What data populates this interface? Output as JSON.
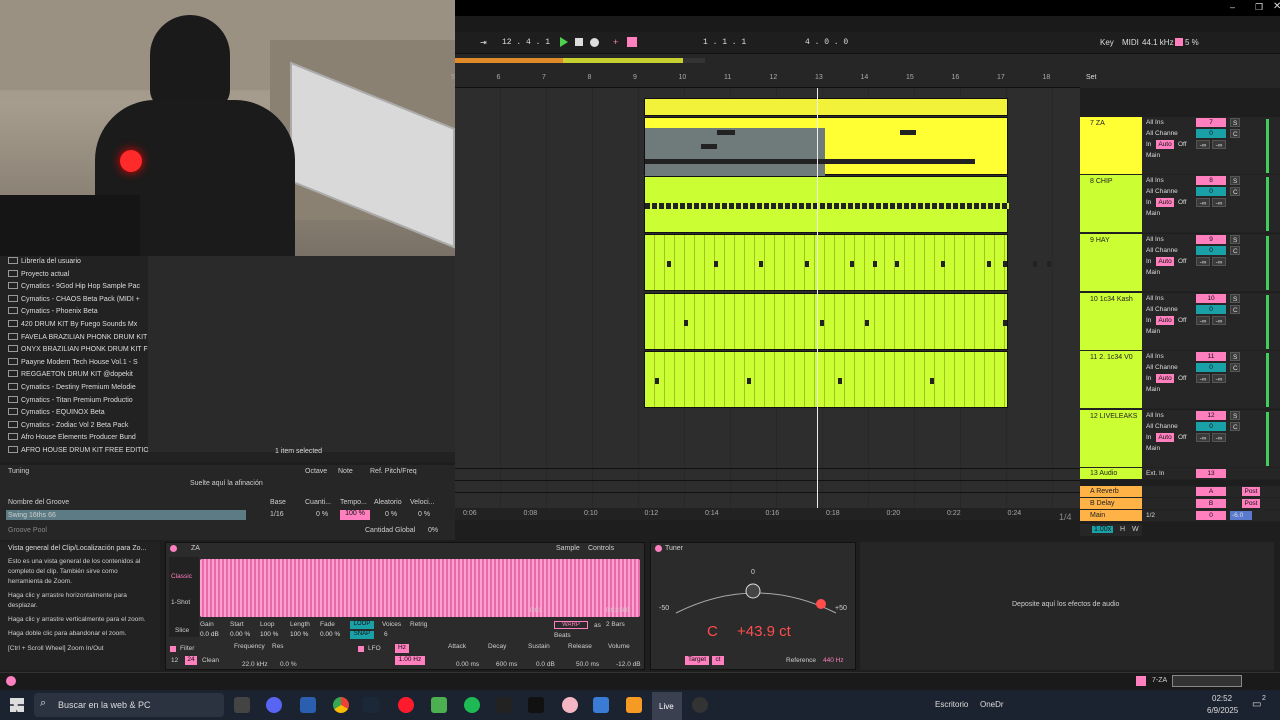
{
  "transport": {
    "tempo_left": "12 . 4 . 1",
    "position": "1 . 1 . 1",
    "loop_len": "4 . 0 . 0",
    "key_label": "Key",
    "midi_label": "MIDI",
    "sample_rate": "44.1 kHz",
    "cpu": "5 %"
  },
  "ruler": {
    "bars": [
      "5",
      "6",
      "7",
      "8",
      "9",
      "10",
      "11",
      "12",
      "13",
      "14",
      "15",
      "16",
      "17",
      "18"
    ],
    "times": [
      "0:06",
      "0:08",
      "0:10",
      "0:12",
      "0:14",
      "0:16",
      "0:18",
      "0:20",
      "0:22",
      "0:24"
    ],
    "zoom_page": "1/4",
    "set_label": "Set"
  },
  "tracks": [
    {
      "name": "7 ZA",
      "num": "7",
      "input": "All Ins",
      "channel": "All Channe",
      "in": "In",
      "auto": "Auto",
      "off": "Off",
      "out": "Main",
      "val": "-∞",
      "vol": "0",
      "s": "S",
      "c": "C",
      "color": "#ffff33"
    },
    {
      "name": "8 CHIP",
      "num": "8",
      "input": "All Ins",
      "channel": "All Channe",
      "in": "In",
      "auto": "Auto",
      "off": "Off",
      "out": "Main",
      "val": "-∞",
      "vol": "0",
      "s": "S",
      "c": "C",
      "color": "#ccff33"
    },
    {
      "name": "9 HAY",
      "num": "9",
      "input": "All Ins",
      "channel": "All Channe",
      "in": "In",
      "auto": "Auto",
      "off": "Off",
      "out": "Main",
      "val": "-∞",
      "vol": "0",
      "s": "S",
      "c": "C",
      "color": "#ccff33"
    },
    {
      "name": "10 1c34 Kash",
      "num": "10",
      "input": "All Ins",
      "channel": "All Channe",
      "in": "In",
      "auto": "Auto",
      "off": "Off",
      "out": "Main",
      "val": "-∞",
      "vol": "0",
      "s": "S",
      "c": "C",
      "color": "#ccff33"
    },
    {
      "name": "11 2. 1c34 V0",
      "num": "11",
      "input": "All Ins",
      "channel": "All Channe",
      "in": "In",
      "auto": "Auto",
      "off": "Off",
      "out": "Main",
      "val": "-∞",
      "vol": "0",
      "s": "S",
      "c": "C",
      "color": "#ccff33"
    },
    {
      "name": "12 LIVELEAKS",
      "num": "12",
      "input": "All Ins",
      "channel": "All Channe",
      "in": "In",
      "auto": "Auto",
      "off": "Off",
      "out": "Main",
      "val": "-∞",
      "vol": "0",
      "s": "S",
      "c": "C",
      "color": "#ccff33"
    }
  ],
  "aux": [
    {
      "name": "13 Audio",
      "input": "Ext. In",
      "num": "13"
    },
    {
      "name": "A Reverb",
      "num": "A",
      "post": "Post"
    },
    {
      "name": "B Delay",
      "num": "B",
      "post": "Post"
    },
    {
      "name": "Main",
      "num": "0",
      "out": "1/2",
      "vol": "-6.0"
    }
  ],
  "main_bottom": {
    "zoom": "1.00x",
    "h": "H",
    "w": "W"
  },
  "browser": {
    "items": [
      "Librería del usuario",
      "Proyecto actual",
      "Cymatics - 9God Hip Hop Sample Pac",
      "Cymatics - CHAOS Beta Pack (MIDI +",
      "Cymatics - Phoenix Beta",
      "420 DRUM KIT By Fuego Sounds Mx",
      "FAVELA BRAZILIAN PHONK DRUM KIT",
      "ONYX BRAZILIAN PHONK DRUM KIT F",
      "Paayne Modern Tech House Vol.1 - S",
      "REGGAETON DRUM KIT @dopekit",
      "Cymatics - Destiny Premium Melodie",
      "Cymatics - Titan Premium Productio",
      "Cymatics - EQUINOX Beta",
      "Cymatics - Zodiac Vol 2 Beta Pack",
      "Afro House Elements Producer Bund",
      "AFRO HOUSE DRUM KIT FREE EDITIOI"
    ],
    "status": "1 item selected"
  },
  "tuning": {
    "title": "Tuning",
    "cols": [
      "Octave",
      "Note",
      "Ref. Pitch/Freq"
    ],
    "drop": "Suelte aquí la afinación"
  },
  "groove": {
    "cols": [
      "Nombre del Groove",
      "Base",
      "Cuanti...",
      "Tempo...",
      "Aleatorio",
      "Veloci..."
    ],
    "row": [
      "Swing 16ths 66",
      "1/16",
      "0 %",
      "100 %",
      "0 %",
      "0 %"
    ],
    "pool": "Groove Pool",
    "global_label": "Cantidad Global",
    "global_val": "0%"
  },
  "info": {
    "title": "Vista general del Clip/Localización para Zo...",
    "p1": "Esto es una vista general de los contenidos al completo del clip. También sirve como herramienta de Zoom.",
    "p2": "Haga clic y arrastre horizontalmente para desplazar.",
    "p3": "Haga clic y arrastre verticalmente para el zoom.",
    "p4": "Haga doble clic para abandonar el zoom.",
    "p5": "[Ctrl + Scroll Wheel] Zoom In/Out"
  },
  "sampler": {
    "title": "ZA",
    "tab1": "Sample",
    "tab2": "Controls",
    "mode": "Classic",
    "oneshot": "1-Shot",
    "slice": "Slice",
    "params": [
      [
        "Gain",
        "0.0 dB"
      ],
      [
        "Start",
        "0.00 %"
      ],
      [
        "Loop",
        "100 %"
      ],
      [
        "Length",
        "100 %"
      ],
      [
        "Fade",
        "0.00 %"
      ]
    ],
    "loop_btn": "LOOP",
    "snap_btn": "SNAP",
    "voices": "Voices",
    "voices_val": "6",
    "retrig": "Retrig",
    "warp": "WARP",
    "as": "as",
    "bars": "2 Bars",
    "beats": "Beats",
    "filter": "Filter",
    "freq": "Frequency",
    "freq_val": "22.0 kHz",
    "res": "Res",
    "res_val": "0.0 %",
    "clean": "Clean",
    "f12": "12",
    "f24": "24",
    "lfo": "LFO",
    "hz": "Hz",
    "lfo_val": "1.00 Hz",
    "attack": "Attack",
    "attack_val": "0.00 ms",
    "decay": "Decay",
    "decay_val": "600 ms",
    "sustain": "Sustain",
    "sustain_val": "0.0 dB",
    "release": "Release",
    "release_val": "50.0 ms",
    "volume": "Volume",
    "volume_val": "-12.0 dB",
    "t1": "0:01",
    "t2": "0:01:500",
    "t3": "0:02",
    "t4": "0:02:500"
  },
  "tuner": {
    "title": "Tuner",
    "zero": "0",
    "minus": "-50",
    "plus": "+50",
    "note": "C",
    "cents": "+43.9 ct",
    "target": "Target",
    "ct": "ct",
    "reference": "Reference",
    "ref_val": "440 Hz"
  },
  "effects_drop": "Deposite aquí los efectos de audio",
  "bottom": {
    "track": "7-ZA"
  },
  "taskbar": {
    "search": "Buscar en la web & PC",
    "desk": "Escritorio",
    "onedrive": "OneDr",
    "time": "02:52",
    "date": "6/9/2025",
    "badge": "2",
    "live": "Live"
  }
}
